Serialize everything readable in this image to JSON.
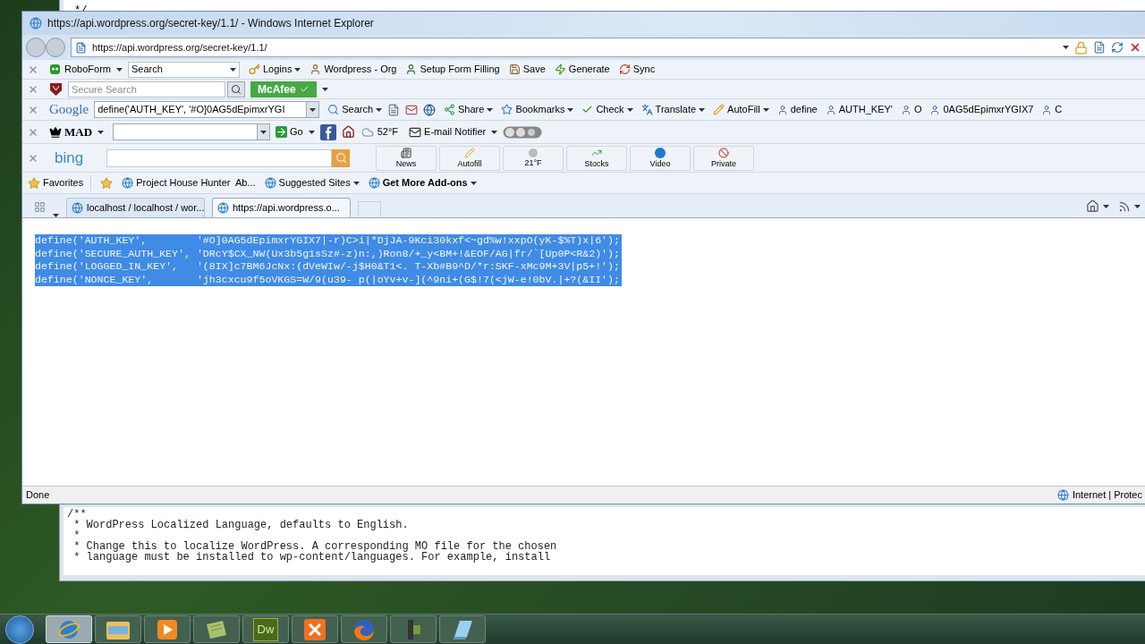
{
  "editor": {
    "top_line": "*/",
    "lines": [
      "/**",
      " * WordPress Localized Language, defaults to English.",
      " *",
      " * Change this to localize WordPress. A corresponding MO file for the chosen",
      " * language must be installed to wp-content/languages. For example, install"
    ]
  },
  "browser": {
    "title": "https://api.wordpress.org/secret-key/1.1/ - Windows Internet Explorer",
    "address": "https://api.wordpress.org/secret-key/1.1/",
    "roboform_bar": {
      "menu": "RoboForm",
      "search": "Search",
      "items": [
        {
          "label": "Logins",
          "dropdown": true
        },
        {
          "label": "Wordpress - Org",
          "dropdown": false
        },
        {
          "label": "Setup Form Filling",
          "dropdown": false
        },
        {
          "label": "Save",
          "dropdown": false
        },
        {
          "label": "Generate",
          "dropdown": false
        },
        {
          "label": "Sync",
          "dropdown": false
        }
      ]
    },
    "security_bar": {
      "placeholder": "Secure Search",
      "badge": "McAfee"
    },
    "google_bar": {
      "logo": "Google",
      "query": "define('AUTH_KEY', '#O]0AG5dEpimxrYGI",
      "items": [
        {
          "label": "Search",
          "dropdown": true
        },
        {
          "label": "Share",
          "dropdown": true
        },
        {
          "label": "Bookmarks",
          "dropdown": true
        },
        {
          "label": "Check",
          "dropdown": true
        },
        {
          "label": "Translate",
          "dropdown": true
        },
        {
          "label": "AutoFill",
          "dropdown": true
        }
      ],
      "terms": [
        "define",
        "AUTH_KEY'",
        "O",
        "0AG5dEpimxrYGIX7",
        "C"
      ]
    },
    "mad_bar": {
      "logo": "MAD",
      "go": "Go",
      "weather": "52°F",
      "notifier": "E-mail Notifier"
    },
    "bing_bar": {
      "logo": "bing",
      "buttons": [
        "News",
        "Autofill",
        "21°F",
        "Stocks",
        "Video",
        "Private"
      ]
    },
    "favorites_bar": {
      "label": "Favorites",
      "links": [
        {
          "label": "Project House Hunter  Ab...",
          "dropdown": false,
          "bold": false
        },
        {
          "label": "Suggested Sites",
          "dropdown": true,
          "bold": false
        },
        {
          "label": "Get More Add-ons",
          "dropdown": true,
          "bold": true
        }
      ]
    },
    "tabs": [
      {
        "label": "localhost / localhost / wor...",
        "selected": false
      },
      {
        "label": "https://api.wordpress.o...",
        "selected": true
      }
    ],
    "content": {
      "highlighted": true,
      "lines": [
        "define('AUTH_KEY',        '#O]0AG5dEpimxrYGIX7|-r)C>i|*DjJA-9Kci30kxf<~gd%w!xxpO(yK-$%T)x|6');",
        "define('SECURE_AUTH_KEY', 'DRcY$CX_NW(Ux3b5g1sSz#-z)n:,)Ron8/+_y<BM+!&EOF/AG|fr/`[Up0P<R&2)');",
        "define('LOGGED_IN_KEY',   '(8IX]c7BM6JcNx:(dVeWIw/-j$H0&T1<. T-Xb#B9^D/*r:SKF-xMc9M+3V|p5+!');",
        "define('NONCE_KEY',       'jh3cxcu9f5oVKGS=W/9(u39- p(|oYv+v-](^9ni+(G$!7(<jW-e!0bV.|+?(&II');"
      ]
    },
    "status_bar": {
      "text": "Done",
      "zone": "Internet | Protec"
    }
  },
  "taskbar": {
    "items": [
      {
        "kind": "globe",
        "active": true
      },
      {
        "kind": "folder",
        "active": false
      },
      {
        "kind": "play",
        "active": false
      },
      {
        "kind": "notes",
        "active": false
      },
      {
        "kind": "label",
        "label": "Dw",
        "active": false
      },
      {
        "kind": "grid",
        "active": false
      },
      {
        "kind": "fox",
        "active": false
      },
      {
        "kind": "tool",
        "active": false
      },
      {
        "kind": "pad",
        "active": false
      }
    ]
  }
}
